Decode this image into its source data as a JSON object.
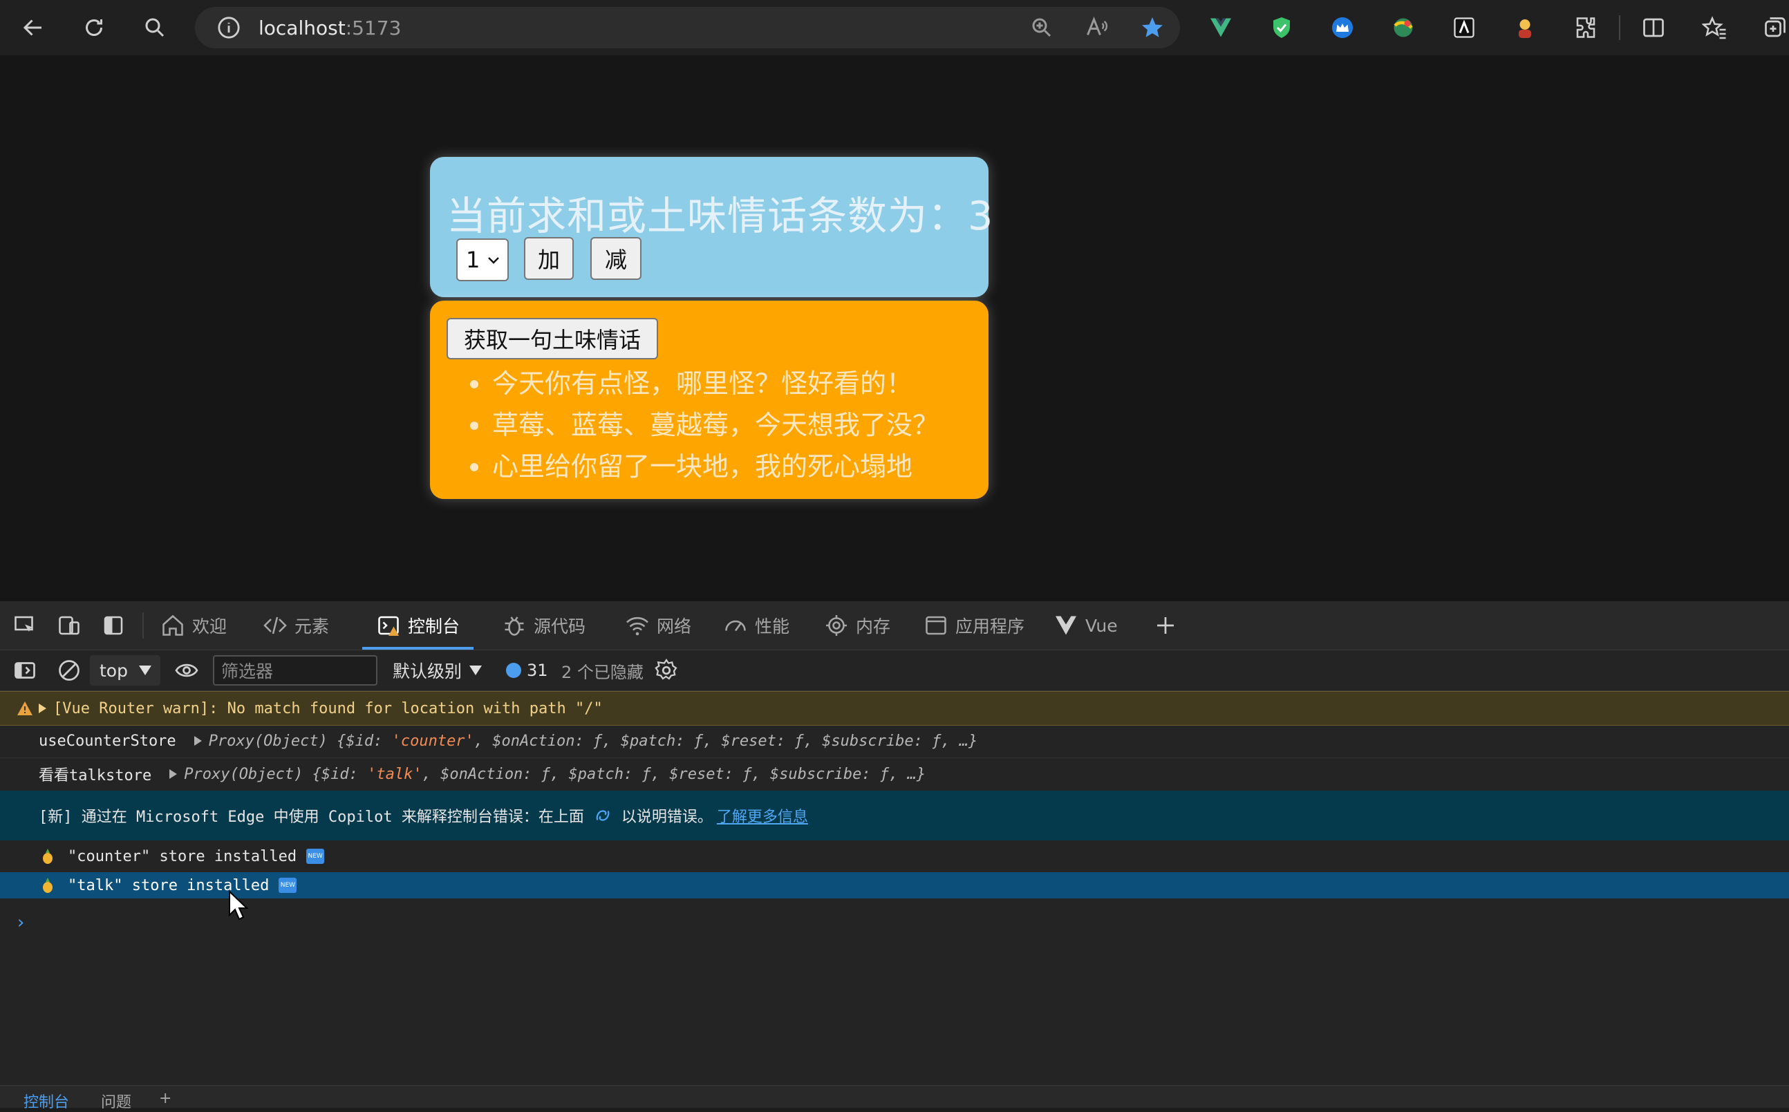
{
  "browser": {
    "url_host": "localhost",
    "url_port": ":5173"
  },
  "count_card": {
    "title": "当前求和或土味情话条数为：3",
    "select_value": "1",
    "add_label": "加",
    "sub_label": "减",
    "bg_color": "#8ecde8"
  },
  "talk_card": {
    "button_label": "获取一句土味情话",
    "items": [
      "今天你有点怪，哪里怪？怪好看的！",
      "草莓、蓝莓、蔓越莓，今天想我了没？",
      "心里给你留了一块地，我的死心塌地"
    ],
    "bg_color": "#ffa500"
  },
  "devtools": {
    "tabs": [
      "欢迎",
      "元素",
      "控制台",
      "源代码",
      "网络",
      "性能",
      "内存",
      "应用程序",
      "Vue"
    ],
    "active_tab": "控制台",
    "context": "top",
    "filter_placeholder": "筛选器",
    "level": "默认级别",
    "message_count": "31",
    "hidden_count": "2 个已隐藏",
    "console": {
      "warn": "[Vue Router warn]: No match found for location with path \"/\"",
      "log1_label": "useCounterStore",
      "log1_proxy": "Proxy(Object)",
      "log1_id": "'counter'",
      "log2_label": "看看talkstore",
      "log2_proxy": "Proxy(Object)",
      "log2_id": "'talk'",
      "obj_open": " {$id: ",
      "obj_rest": ", $onAction: ƒ, $patch: ƒ, $reset: ƒ, $subscribe: ƒ, …}",
      "info_pre": "[新] 通过在 Microsoft Edge 中使用 Copilot 来解释控制台错误：在上面",
      "info_mid": "以说明错误。",
      "info_link": "了解更多信息",
      "store1": "\"counter\" store installed",
      "store2": "\"talk\" store installed",
      "new_badge": "NEW"
    },
    "drawer_tabs": [
      "控制台",
      "问题"
    ]
  }
}
